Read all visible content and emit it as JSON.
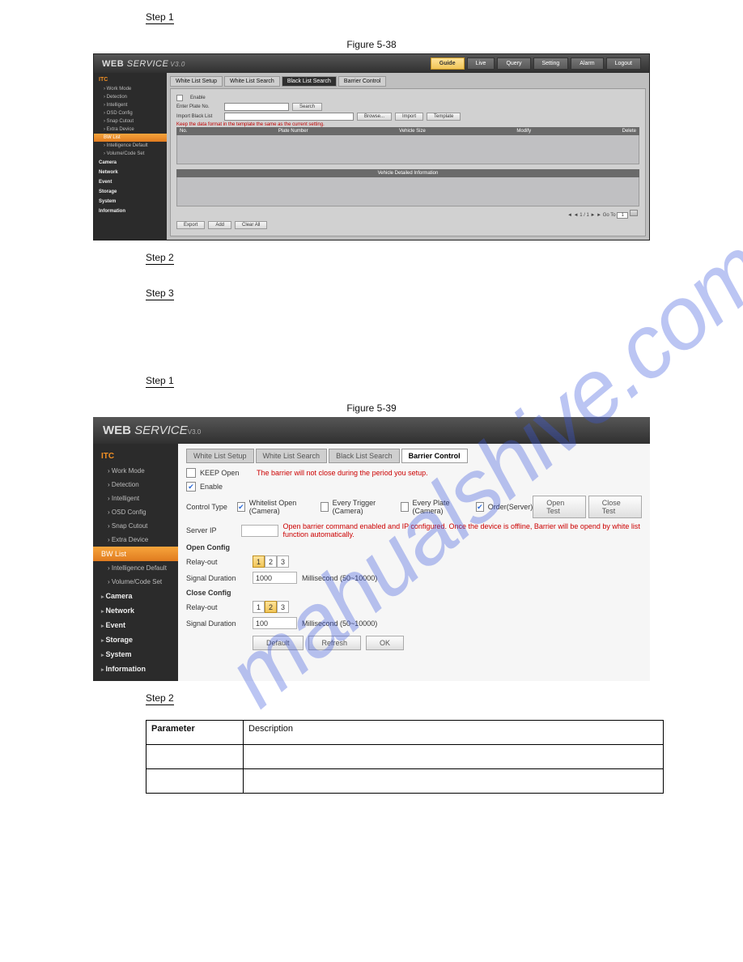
{
  "watermark": "mahualshive.com",
  "labels": {
    "step1": "Step 1",
    "step2": "Step 2",
    "step3": "Step 3",
    "fig38": "Figure 5-38",
    "fig39": "Figure 5-39"
  },
  "brand": {
    "web": "WEB",
    "service": "SERVICE",
    "ver": "V3.0"
  },
  "topnav": {
    "guide": "Guide",
    "live": "Live",
    "query": "Query",
    "setting": "Setting",
    "alarm": "Alarm",
    "logout": "Logout"
  },
  "side": {
    "itc": "ITC",
    "work_mode": "Work Mode",
    "detection": "Detection",
    "intelligent": "Intelligent",
    "osd": "OSD Config",
    "snap": "Snap Cutout",
    "extra": "Extra Device",
    "bw": "BW List",
    "idef": "Intelligence Default",
    "vcs": "Volume/Code Set",
    "camera": "Camera",
    "network": "Network",
    "event": "Event",
    "storage": "Storage",
    "system": "System",
    "info": "Information"
  },
  "f38": {
    "tabs": {
      "wls": "White List Setup",
      "wlsr": "White List Search",
      "bls": "Black List Search",
      "bc": "Barrier Control"
    },
    "enable": "Enable",
    "enter_plate": "Enter Plate No.",
    "search": "Search",
    "import_black": "Import Black List",
    "browse": "Browse...",
    "import": "Import",
    "template": "Template",
    "warn": "Keep the data format in the template the same as the current setting.",
    "cols": {
      "no": "No.",
      "plate": "Plate Number",
      "vsize": "Vehicle Size",
      "modify": "Modify",
      "delete": "Delete"
    },
    "detail_hdr": "Vehicle Detailed Information",
    "pag": "◄ ◄ 1 / 1 ► ►  Go To",
    "p1": "1",
    "export": "Export",
    "add": "Add",
    "clear": "Clear All"
  },
  "f39": {
    "tabs": {
      "wls": "White List Setup",
      "wlsr": "White List Search",
      "bls": "Black List Search",
      "bc": "Barrier Control"
    },
    "keep_open": "KEEP Open",
    "keep_note": "The barrier will not close during the period you setup.",
    "enable": "Enable",
    "control_type": "Control Type",
    "ct1": "Whitelist Open (Camera)",
    "ct2": "Every Trigger (Camera)",
    "ct3": "Every Plate (Camera)",
    "ct4": "Order(Server)",
    "open_test": "Open Test",
    "close_test": "Close Test",
    "server_ip": "Server IP",
    "server_note": "Open barrier command enabled and IP configured. Once the device is offline, Barrier will be opend by white list function automatically.",
    "open_cfg": "Open Config",
    "close_cfg": "Close Config",
    "relay_out": "Relay-out",
    "sig": "Signal Duration",
    "sig_unit": "Millisecond (50~10000)",
    "sig_open": "1000",
    "sig_close": "100",
    "r1": "1",
    "r2": "2",
    "r3": "3",
    "default": "Default",
    "refresh": "Refresh",
    "ok": "OK"
  },
  "table": {
    "h1": "Parameter",
    "h2": "Description",
    "r1c1": "",
    "r1c2": "",
    "r2c1": "",
    "r2c2": ""
  }
}
